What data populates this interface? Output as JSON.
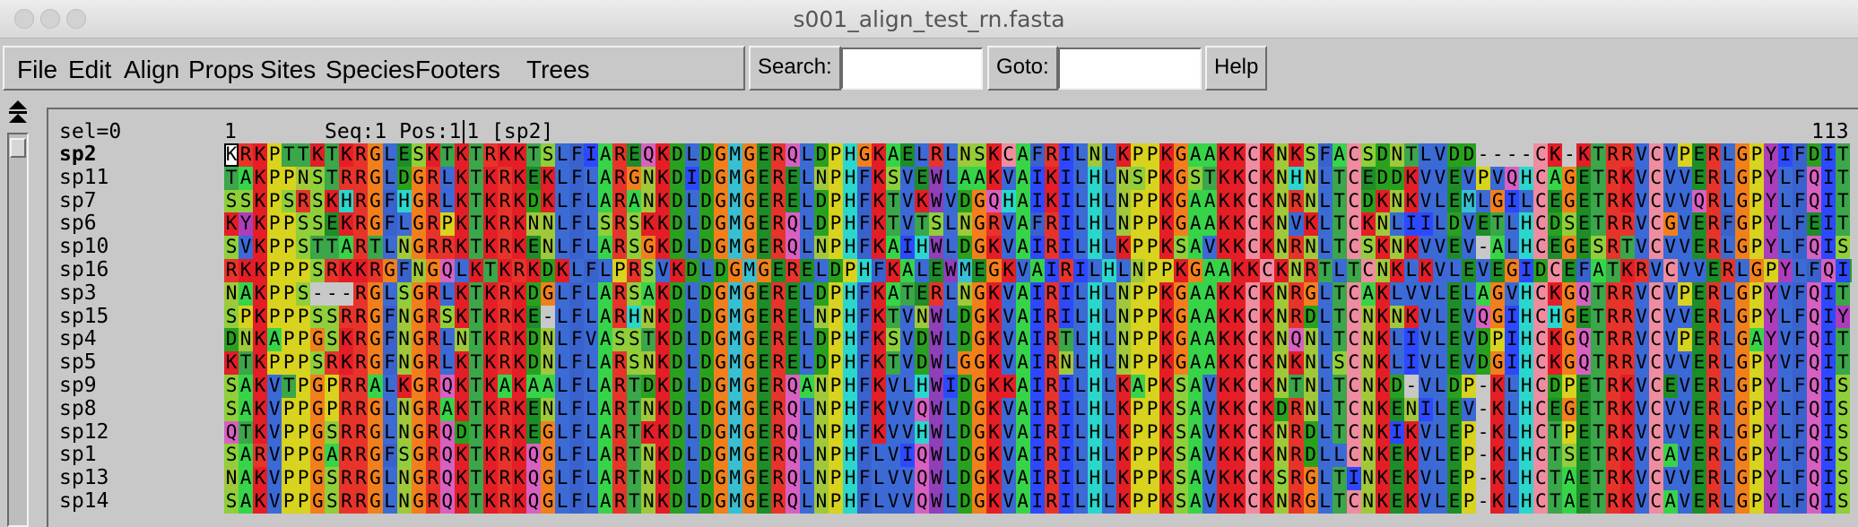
{
  "window": {
    "title": "s001_align_test_rn.fasta"
  },
  "menu": [
    "File",
    "Edit",
    "Align",
    "Props",
    "Sites",
    "Species",
    "Footers",
    "Trees"
  ],
  "search": {
    "label": "Search:",
    "value": ""
  },
  "goto": {
    "label": "Goto:",
    "value": ""
  },
  "help_label": "Help",
  "header": {
    "sel": "sel=0",
    "start": "1",
    "seqpos_prefix": "Seq:1 Pos:1",
    "seqpos_suffix": "1 [sp2]",
    "end": "113"
  },
  "alignment": {
    "current_row": 0,
    "cursor_col": 0,
    "rows": [
      {
        "name": "sp2",
        "seq": "KRKPTTKTKRGLESKTKTRKKTSLFIAREQKDLDGMGERQLDPHGKAELRLNSKCAFRILNLKPPKGAAKKCKNKSFACSDNTLVDD----CK-KTRRVCVPERLGPYIFDIT"
      },
      {
        "name": "sp11",
        "seq": "TAKPPNSTRRGLDGRLKTKRKEKLFLARGNKDIDGMGERELNPHFKSVEWLAAKVAIKILHLNSPKGSTKKCKNHNLTCEDDKVVEVPVQHCAGETRKVCVVERLGPYLFQIT"
      },
      {
        "name": "sp7",
        "seq": "SSKPSRSKHRGFHGRLKTKRKDKLFLARANKDLDGMGERELDPHFKTVKWVDGQHAIKILHLNPPKGAAKKCKNRNLTCDKNKVLEMLGILCEGETRKVCVVQRLGPYLFQIT"
      },
      {
        "name": "sp6",
        "seq": "KYKPPSSEKRGFLGRPKTKRKNNLFLSRSKKDLDGMGERQLDPHFKTVTSLNGRVAFRILHLNPPKGAAKKCKNVKLTCKNLIILDVETLHCDSETRRVCGVERFGPYLFEIT"
      },
      {
        "name": "sp10",
        "seq": "SVKPPSTTARTLNGRRKTKRKENLFLARSGKDLDGMGERQLNPHFKAIHWLDGKVAIRILHLKPPKSAVKKCKNRNLTCSKNKVVEV-ALHCEGESRTVCVVERLGPYLFQIS"
      },
      {
        "name": "sp16",
        "seq": "RKKPPPSRKKRGFNGQLKTKRKDKLFLPRSVKDLDGMGERELDPHFKALEWMEGKVAIRILHLNPPKGAAKKCKNRTLTCNKLKVLEVEGIDCEFATKRVCVVERLGPYLFQID"
      },
      {
        "name": "sp3",
        "seq": "NAKPPS---RGLSGRLKTKRKDGLFLARSAKDLDGMGERELDPHFKATERLNGKVAIRILHLNPPKGAAKKCKNRGLTCAKLVVLELAGVHCKGQTRRVCVPERLGPYVFQIT"
      },
      {
        "name": "sp15",
        "seq": "SPKPPPSSRRGFNGRSKTKRKE-LFLARHNKDLDGMGERELNPHFKTVNWLDGKVAIRILHLNPPKGAAKKCKNRDLTCNKNKVLEVQGIHCHGETRRVCVVERLGPYLFQIY"
      },
      {
        "name": "sp4",
        "seq": "DNKAPPGSKRGFNGRLNTKRKDNLFVASSTKDLDGMGERELDPHFKSVDWLDGKVAIRTLHLNPPKGAAKKCKNQNLTCNKLIVLEVDPIHCKGQTRRVCVPERLGAYVFQIT"
      },
      {
        "name": "sp5",
        "seq": "KTKPPPSRKRGFNGRLKTKRKDNLFLARSNKDLDGMGERELDPHFKTVDWLGGKVAIRNLHLNPPKGAAKKCKNKNLSCNKLIVLEVDGIHCKGQTRRVCVVERLGPYVFQIT"
      },
      {
        "name": "sp9",
        "seq": "SAKVTPGPRRALKGRQKTKAKAALFLARTDKDLDGMGERQANPHFKVLHWIDGKKAIRILHLKAPKSAVKKCKNTNLTCNKD-VLDP-KLHCDPETRKVCEVERLGPYLFQIS"
      },
      {
        "name": "sp8",
        "seq": "SAKVPPGPRRGLNGRAKTKRKENLFLARTNKDLDGMGERQLNPHFKVVQWLDGKVAIRILHLKPPKSAVKKCKDRNLTCNKENILEV-KLHCEGETRKVCVVERLGPYLFQIS"
      },
      {
        "name": "sp12",
        "seq": "QTKVPPGSRRGLNGRQDTKRKEGLFLARTKKDLDGMGERQLNPHFKVVHWLDGKVAIRILHLKPPKSAVKKCKNRDLTCNKIKVLEP-KLHCTPETRKVCVVERLGPYLFQIS"
      },
      {
        "name": "sp1",
        "seq": "SARVPPGARRGFSGRQKTKRKQGLFLARTNKDLDGMGERQLNPHFLVIQWLDGKVAIRILHLKPPKSAVKKCKNRDLLCNKEKVLEP-KLHCTSETRKVCAVERLGPYLFQIS"
      },
      {
        "name": "sp13",
        "seq": "NAKVPPGSRRGLNGRQKTKRKQGLFLARTNKDLDGMGERQLNPHFLVVQWLDGKVAIRILHLKPPKSAVKKCKSRGLTINKEKVLEP-KLHCTAETRKVCVVERLGPYLFQIS"
      },
      {
        "name": "sp14",
        "seq": "SAKVPPGSRRGLNGRQKTKRKQGLFLARTNKDLDGMGERQLNPHFLVVQWLDGKVAIRILHLKPPKSAVKKCKNRGLTCNKEKVLEP-KLHCTAETRKVCAVERLGPYLFQIS"
      }
    ]
  },
  "residue_colors": {
    "A": "#37d449",
    "B": "#aaaaaa",
    "C": "#ef8ca0",
    "D": "#29a11f",
    "E": "#1d8d28",
    "F": "#3a62cc",
    "G": "#f1801c",
    "H": "#2bd7cc",
    "I": "#2d49ff",
    "J": "#aaaaaa",
    "K": "#e41e26",
    "L": "#3c6bd5",
    "M": "#39bfd1",
    "N": "#a0c83a",
    "O": "#aaaaaa",
    "P": "#d7d31e",
    "Q": "#d860c2",
    "R": "#e7342b",
    "S": "#8fcf3a",
    "T": "#3ba64a",
    "U": "#aaaaaa",
    "V": "#3b69d6",
    "W": "#8f3fb8",
    "X": "#aaaaaa",
    "Y": "#ad3dbb",
    "Z": "#aaaaaa",
    "-": "#c8c8c8"
  }
}
